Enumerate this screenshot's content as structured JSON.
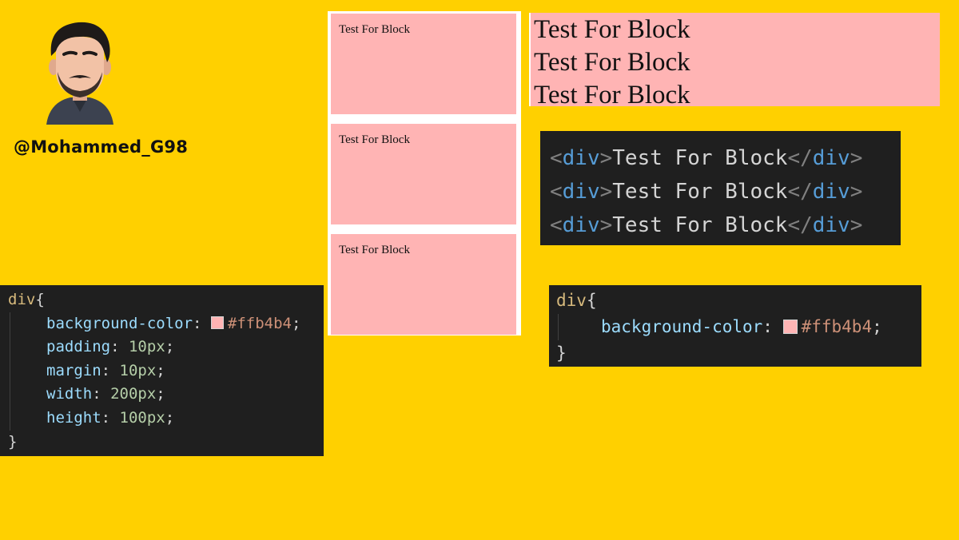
{
  "author": {
    "handle": "@Mohammed_G98"
  },
  "preview_boxes": [
    "Test For Block",
    "Test For Block",
    "Test For Block"
  ],
  "block_lines": [
    "Test For Block",
    "Test For Block",
    "Test For Block"
  ],
  "html_code": {
    "lines": [
      {
        "open_lt": "<",
        "open_tag": "div",
        "open_gt": ">",
        "text": "Test For Block",
        "close_lt": "</",
        "close_tag": "div",
        "close_gt": ">"
      },
      {
        "open_lt": "<",
        "open_tag": "div",
        "open_gt": ">",
        "text": "Test For Block",
        "close_lt": "</",
        "close_tag": "div",
        "close_gt": ">"
      },
      {
        "open_lt": "<",
        "open_tag": "div",
        "open_gt": ">",
        "text": "Test For Block",
        "close_lt": "</",
        "close_tag": "div",
        "close_gt": ">"
      }
    ]
  },
  "css_full": {
    "selector": "div",
    "open_brace": "{",
    "close_brace": "}",
    "bg_prop": "background-color",
    "bg_value": "#ffb4b4",
    "padding_prop": "padding",
    "padding_value": "10px",
    "margin_prop": "margin",
    "margin_value": "10px",
    "width_prop": "width",
    "width_value": "200px",
    "height_prop": "height",
    "height_value": "100px"
  },
  "css_short": {
    "selector": "div",
    "open_brace": "{",
    "close_brace": "}",
    "bg_prop": "background-color",
    "bg_value": "#ffb4b4"
  },
  "colors": {
    "background": "#ffd000",
    "block_pink": "#ffb4b4",
    "code_bg": "#1f1f1f"
  }
}
